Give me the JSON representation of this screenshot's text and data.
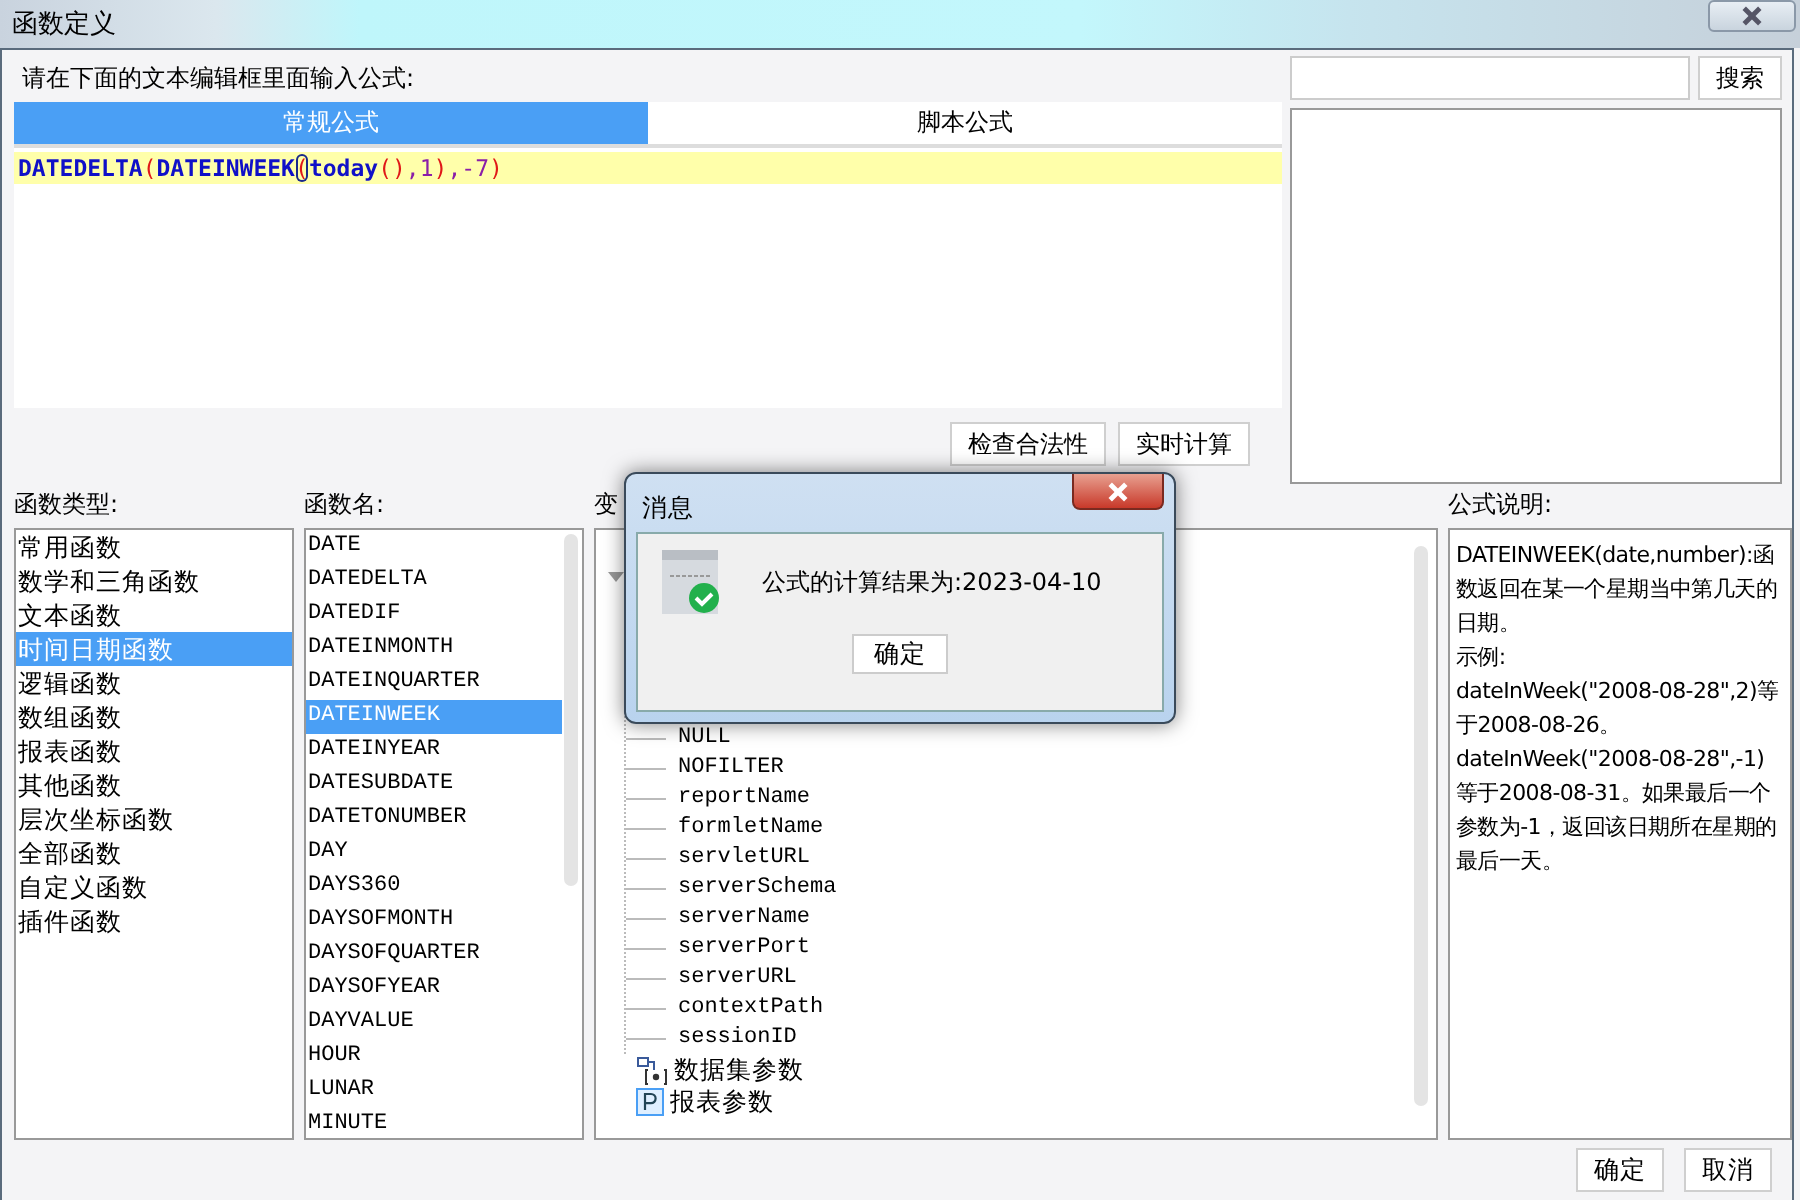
{
  "window": {
    "title": "函数定义"
  },
  "editor": {
    "prompt": "请在下面的文本编辑框里面输入公式:",
    "tabs": [
      {
        "label": "常规公式",
        "selected": true
      },
      {
        "label": "脚本公式",
        "selected": false
      }
    ],
    "formula": [
      {
        "text": "DATEDELTA",
        "kind": "func"
      },
      {
        "text": "(",
        "kind": "paren"
      },
      {
        "text": "DATEINWEEK",
        "kind": "func"
      },
      {
        "text": "(",
        "kind": "paren",
        "highlighted": true
      },
      {
        "text": "today",
        "kind": "func"
      },
      {
        "text": "()",
        "kind": "paren"
      },
      {
        "text": ",1",
        "kind": "number"
      },
      {
        "text": ")",
        "kind": "paren"
      },
      {
        "text": ",-7",
        "kind": "number"
      },
      {
        "text": ")",
        "kind": "paren"
      }
    ],
    "buttons": [
      "检查合法性",
      "实时计算"
    ]
  },
  "search": {
    "button": "搜索"
  },
  "function_types": {
    "label": "函数类型:",
    "items": [
      {
        "label": "常用函数",
        "selected": false
      },
      {
        "label": "数学和三角函数",
        "selected": false
      },
      {
        "label": "文本函数",
        "selected": false
      },
      {
        "label": "时间日期函数",
        "selected": true
      },
      {
        "label": "逻辑函数",
        "selected": false
      },
      {
        "label": "数组函数",
        "selected": false
      },
      {
        "label": "报表函数",
        "selected": false
      },
      {
        "label": "其他函数",
        "selected": false
      },
      {
        "label": "层次坐标函数",
        "selected": false
      },
      {
        "label": "全部函数",
        "selected": false
      },
      {
        "label": "自定义函数",
        "selected": false
      },
      {
        "label": "插件函数",
        "selected": false
      }
    ]
  },
  "function_names": {
    "label": "函数名:",
    "items": [
      {
        "label": "DATE",
        "selected": false
      },
      {
        "label": "DATEDELTA",
        "selected": false
      },
      {
        "label": "DATEDIF",
        "selected": false
      },
      {
        "label": "DATEINMONTH",
        "selected": false
      },
      {
        "label": "DATEINQUARTER",
        "selected": false
      },
      {
        "label": "DATEINWEEK",
        "selected": true
      },
      {
        "label": "DATEINYEAR",
        "selected": false
      },
      {
        "label": "DATESUBDATE",
        "selected": false
      },
      {
        "label": "DATETONUMBER",
        "selected": false
      },
      {
        "label": "DAY",
        "selected": false
      },
      {
        "label": "DAYS360",
        "selected": false
      },
      {
        "label": "DAYSOFMONTH",
        "selected": false
      },
      {
        "label": "DAYSOFQUARTER",
        "selected": false
      },
      {
        "label": "DAYSOFYEAR",
        "selected": false
      },
      {
        "label": "DAYVALUE",
        "selected": false
      },
      {
        "label": "HOUR",
        "selected": false
      },
      {
        "label": "LUNAR",
        "selected": false
      },
      {
        "label": "MINUTE",
        "selected": false
      }
    ]
  },
  "variables": {
    "label": "变",
    "group": {
      "expanded": true,
      "children": [
        "NULL",
        "NOFILTER",
        "reportName",
        "formletName",
        "servletURL",
        "serverSchema",
        "serverName",
        "serverPort",
        "serverURL",
        "contextPath",
        "sessionID"
      ]
    },
    "items": [
      {
        "label": "数据集参数",
        "kind": "dataset"
      },
      {
        "label": "报表参数",
        "kind": "parameter"
      }
    ]
  },
  "description": {
    "label": "公式说明:",
    "paragraphs": [
      "DATEINWEEK(date,number):函数返回在某一个星期当中第几天的日期。",
      "示例:",
      "dateInWeek(\"2008-08-28\",2)等于2008-08-26。",
      "dateInWeek(\"2008-08-28\",-1)等于2008-08-31。如果最后一个参数为-1，返回该日期所在星期的最后一天。"
    ]
  },
  "footer_buttons": [
    "确定",
    "取消"
  ],
  "message": {
    "title": "消息",
    "text": "公式的计算结果为:2023-04-10",
    "button": "确定"
  }
}
